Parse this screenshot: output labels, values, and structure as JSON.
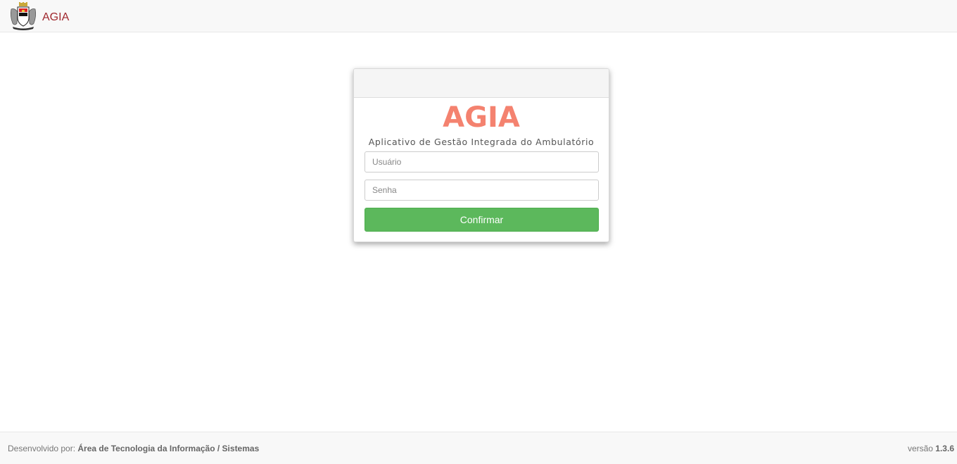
{
  "navbar": {
    "brand": "AGIA",
    "logo_icon": "coat-of-arms-icon"
  },
  "login": {
    "title": "AGIA",
    "subtitle": "Aplicativo de Gestão Integrada do Ambulatório",
    "username_placeholder": "Usuário",
    "username_value": "",
    "password_placeholder": "Senha",
    "password_value": "",
    "confirm_label": "Confirmar"
  },
  "footer": {
    "developed_by_label": "Desenvolvido por: ",
    "developed_by_value": "Área de Tecnologia da Informação / Sistemas",
    "version_label": "versão ",
    "version_value": "1.3.6"
  },
  "colors": {
    "brand": "#a0282e",
    "title": "#f4826f",
    "confirm": "#5cb85c"
  }
}
